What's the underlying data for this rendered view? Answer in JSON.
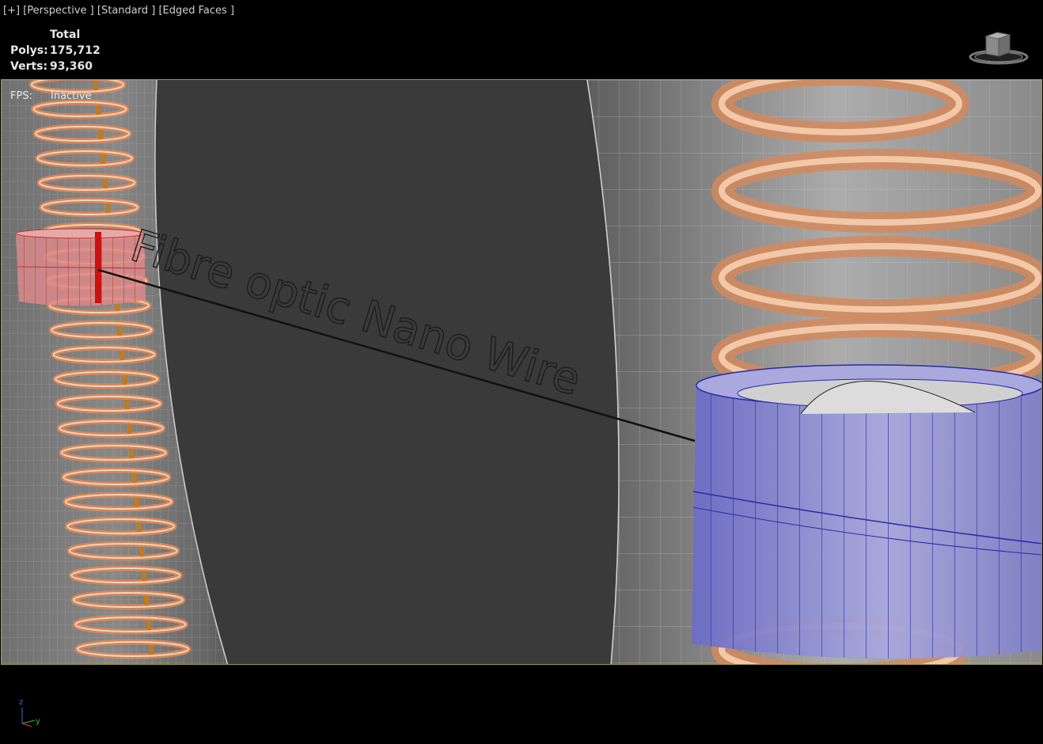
{
  "viewport": {
    "labels": [
      "[+]",
      "[Perspective ]",
      "[Standard ]",
      "[Edged Faces ]"
    ]
  },
  "stats": {
    "header": "Total",
    "polys_label": "Polys:",
    "polys_value": "175,712",
    "verts_label": "Verts:",
    "verts_value": "93,360"
  },
  "fps": {
    "label": "FPS:",
    "value": "Inactive"
  },
  "scene": {
    "text_object": "Fibre optic Nano Wire"
  },
  "colors": {
    "background": "#000000",
    "viewport_fill": "#3a3a3a",
    "viewport_border": "#9c9438",
    "spring_orange": "#d9885a",
    "selected_red": "#c23a3a",
    "selected_blue": "#3a3acc",
    "tube_gray": "#8e8e8e"
  },
  "icons": [
    "viewcube-icon",
    "axis-tripod-icon"
  ]
}
